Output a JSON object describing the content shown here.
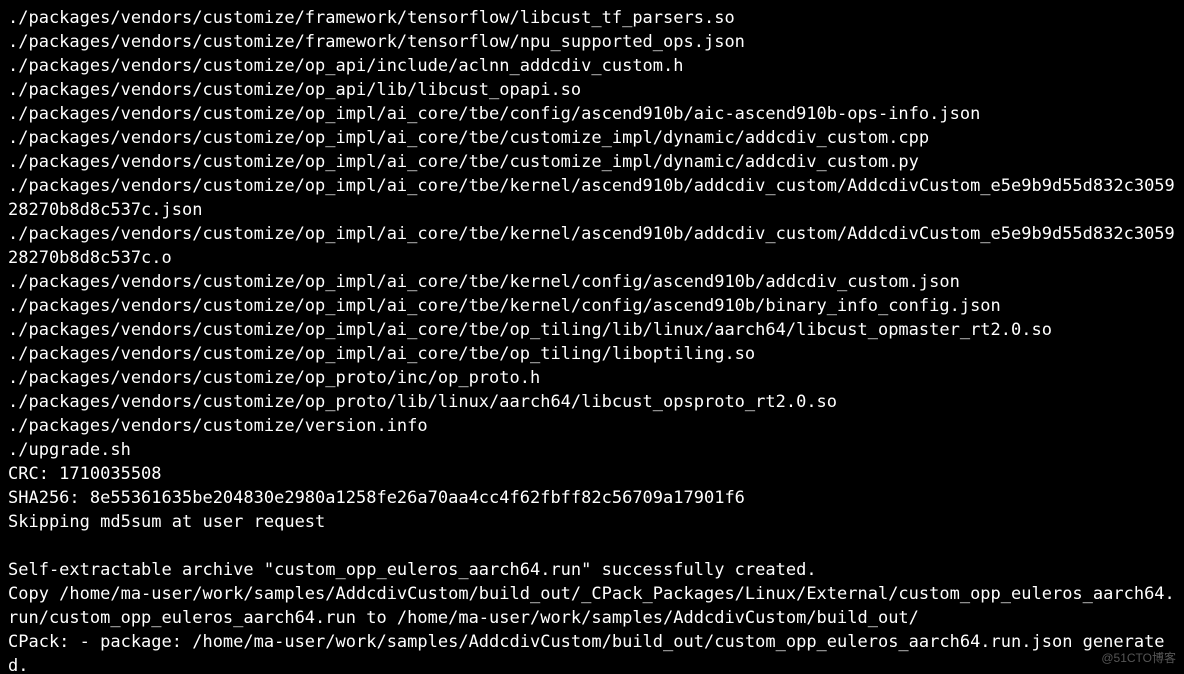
{
  "terminal": {
    "lines": [
      "./packages/vendors/customize/framework/tensorflow/libcust_tf_parsers.so",
      "./packages/vendors/customize/framework/tensorflow/npu_supported_ops.json",
      "./packages/vendors/customize/op_api/include/aclnn_addcdiv_custom.h",
      "./packages/vendors/customize/op_api/lib/libcust_opapi.so",
      "./packages/vendors/customize/op_impl/ai_core/tbe/config/ascend910b/aic-ascend910b-ops-info.json",
      "./packages/vendors/customize/op_impl/ai_core/tbe/customize_impl/dynamic/addcdiv_custom.cpp",
      "./packages/vendors/customize/op_impl/ai_core/tbe/customize_impl/dynamic/addcdiv_custom.py",
      "./packages/vendors/customize/op_impl/ai_core/tbe/kernel/ascend910b/addcdiv_custom/AddcdivCustom_e5e9b9d55d832c305928270b8d8c537c.json",
      "./packages/vendors/customize/op_impl/ai_core/tbe/kernel/ascend910b/addcdiv_custom/AddcdivCustom_e5e9b9d55d832c305928270b8d8c537c.o",
      "./packages/vendors/customize/op_impl/ai_core/tbe/kernel/config/ascend910b/addcdiv_custom.json",
      "./packages/vendors/customize/op_impl/ai_core/tbe/kernel/config/ascend910b/binary_info_config.json",
      "./packages/vendors/customize/op_impl/ai_core/tbe/op_tiling/lib/linux/aarch64/libcust_opmaster_rt2.0.so",
      "./packages/vendors/customize/op_impl/ai_core/tbe/op_tiling/liboptiling.so",
      "./packages/vendors/customize/op_proto/inc/op_proto.h",
      "./packages/vendors/customize/op_proto/lib/linux/aarch64/libcust_opsproto_rt2.0.so",
      "./packages/vendors/customize/version.info",
      "./upgrade.sh",
      "CRC: 1710035508",
      "SHA256: 8e55361635be204830e2980a1258fe26a70aa4cc4f62fbff82c56709a17901f6",
      "Skipping md5sum at user request",
      "",
      "Self-extractable archive \"custom_opp_euleros_aarch64.run\" successfully created.",
      "Copy /home/ma-user/work/samples/AddcdivCustom/build_out/_CPack_Packages/Linux/External/custom_opp_euleros_aarch64.run/custom_opp_euleros_aarch64.run to /home/ma-user/work/samples/AddcdivCustom/build_out/",
      "CPack: - package: /home/ma-user/work/samples/AddcdivCustom/build_out/custom_opp_euleros_aarch64.run.json generated."
    ]
  },
  "watermark": "@51CTO博客"
}
